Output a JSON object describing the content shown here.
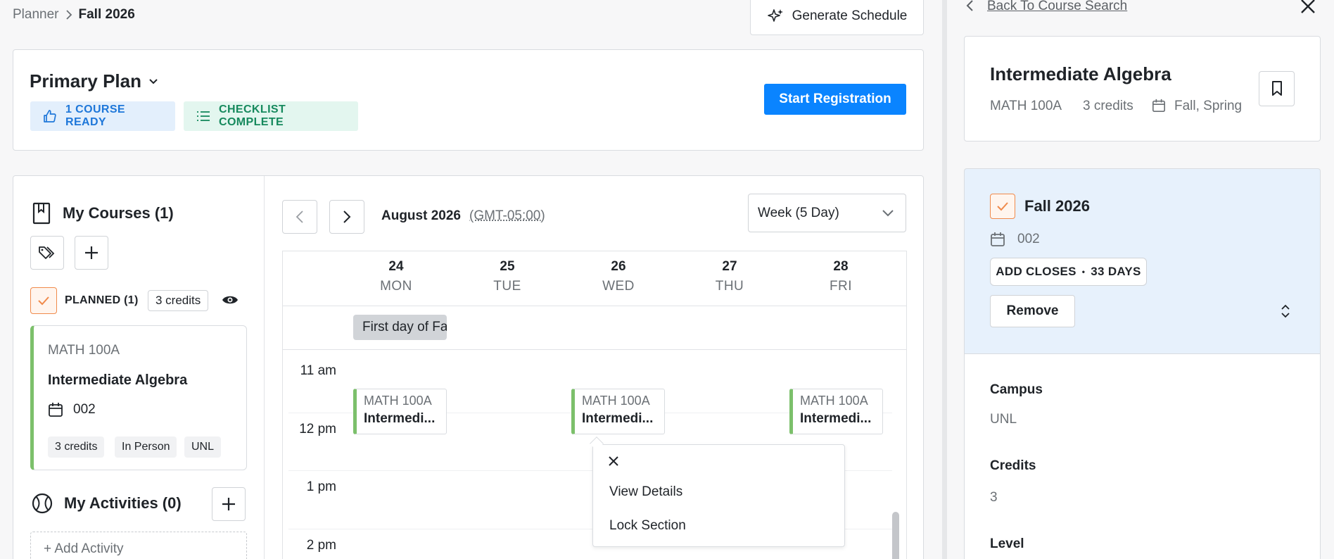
{
  "breadcrumb": {
    "parent": "Planner",
    "current": "Fall 2026"
  },
  "header": {
    "generate_label": "Generate Schedule"
  },
  "plan": {
    "title": "Primary Plan",
    "badge_ready": "1 COURSE READY",
    "badge_checklist": "CHECKLIST COMPLETE",
    "start_label": "Start Registration"
  },
  "courses": {
    "title": "My Courses (1)",
    "planned_label": "PLANNED (1)",
    "credits_pill": "3 credits",
    "card": {
      "code": "MATH 100A",
      "name": "Intermediate Algebra",
      "section": "002",
      "tags": [
        "3 credits",
        "In Person",
        "UNL"
      ]
    }
  },
  "activities": {
    "title": "My Activities (0)",
    "add_label": "+ Add Activity"
  },
  "calendar": {
    "month": "August 2026",
    "timezone": "(GMT-05:00)",
    "view": "Week (5 Day)",
    "days": [
      {
        "num": "24",
        "name": "MON"
      },
      {
        "num": "25",
        "name": "TUE"
      },
      {
        "num": "26",
        "name": "WED"
      },
      {
        "num": "27",
        "name": "THU"
      },
      {
        "num": "28",
        "name": "FRI"
      }
    ],
    "allday_event": "First day of Fa",
    "times": [
      "11 am",
      "12 pm",
      "1 pm",
      "2 pm"
    ],
    "event": {
      "code": "MATH 100A",
      "name": "Intermedi..."
    },
    "popover": {
      "view_details": "View Details",
      "lock_section": "Lock Section"
    }
  },
  "panel": {
    "back_label": "Back To Course Search",
    "course_title": "Intermediate Algebra",
    "code": "MATH 100A",
    "credits": "3 credits",
    "terms": "Fall, Spring",
    "term_title": "Fall 2026",
    "section": "002",
    "closes_label": "ADD CLOSES",
    "closes_days": "33 DAYS",
    "remove_label": "Remove",
    "campus_label": "Campus",
    "campus_value": "UNL",
    "credits_label": "Credits",
    "credits_value": "3",
    "level_label": "Level"
  },
  "colors": {
    "primary": "#0a84ff",
    "ready_badge": "#1e77d9",
    "checklist_badge": "#16895d",
    "event_accent": "#7cc06b",
    "check_orange": "#f08a4b",
    "term_background": "#e7f1fc"
  }
}
